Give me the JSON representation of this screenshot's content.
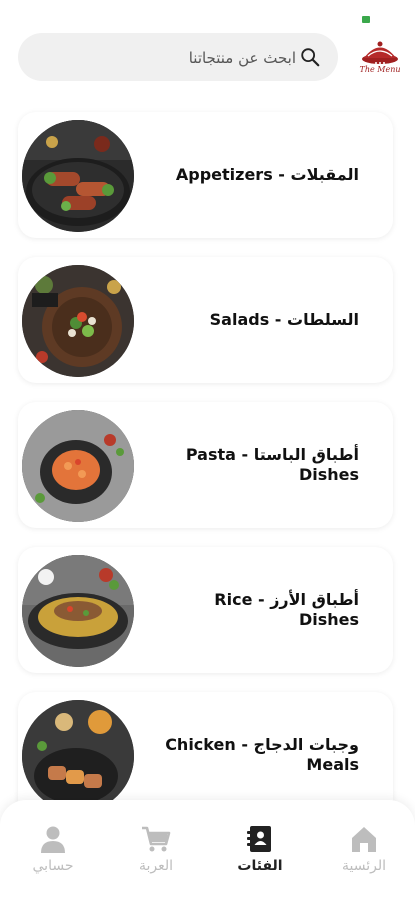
{
  "search": {
    "placeholder": "ابحث عن منتجاتنا"
  },
  "logo": {
    "text": "The Menu"
  },
  "categories": [
    {
      "label": "Appetizers - المقبلات"
    },
    {
      "label": "Salads - السلطات"
    },
    {
      "label": "Pasta - أطباق الباستا Dishes"
    },
    {
      "label": "Rice - أطباق الأرز Dishes"
    },
    {
      "label": "Chicken - وجبات الدجاج Meals"
    }
  ],
  "nav": {
    "home": "الرئسية",
    "categories": "الفئات",
    "cart": "العربة",
    "account": "حسابي"
  },
  "colors": {
    "brand": "#a02020",
    "active": "#222222",
    "inactive": "#bdbdbd"
  }
}
